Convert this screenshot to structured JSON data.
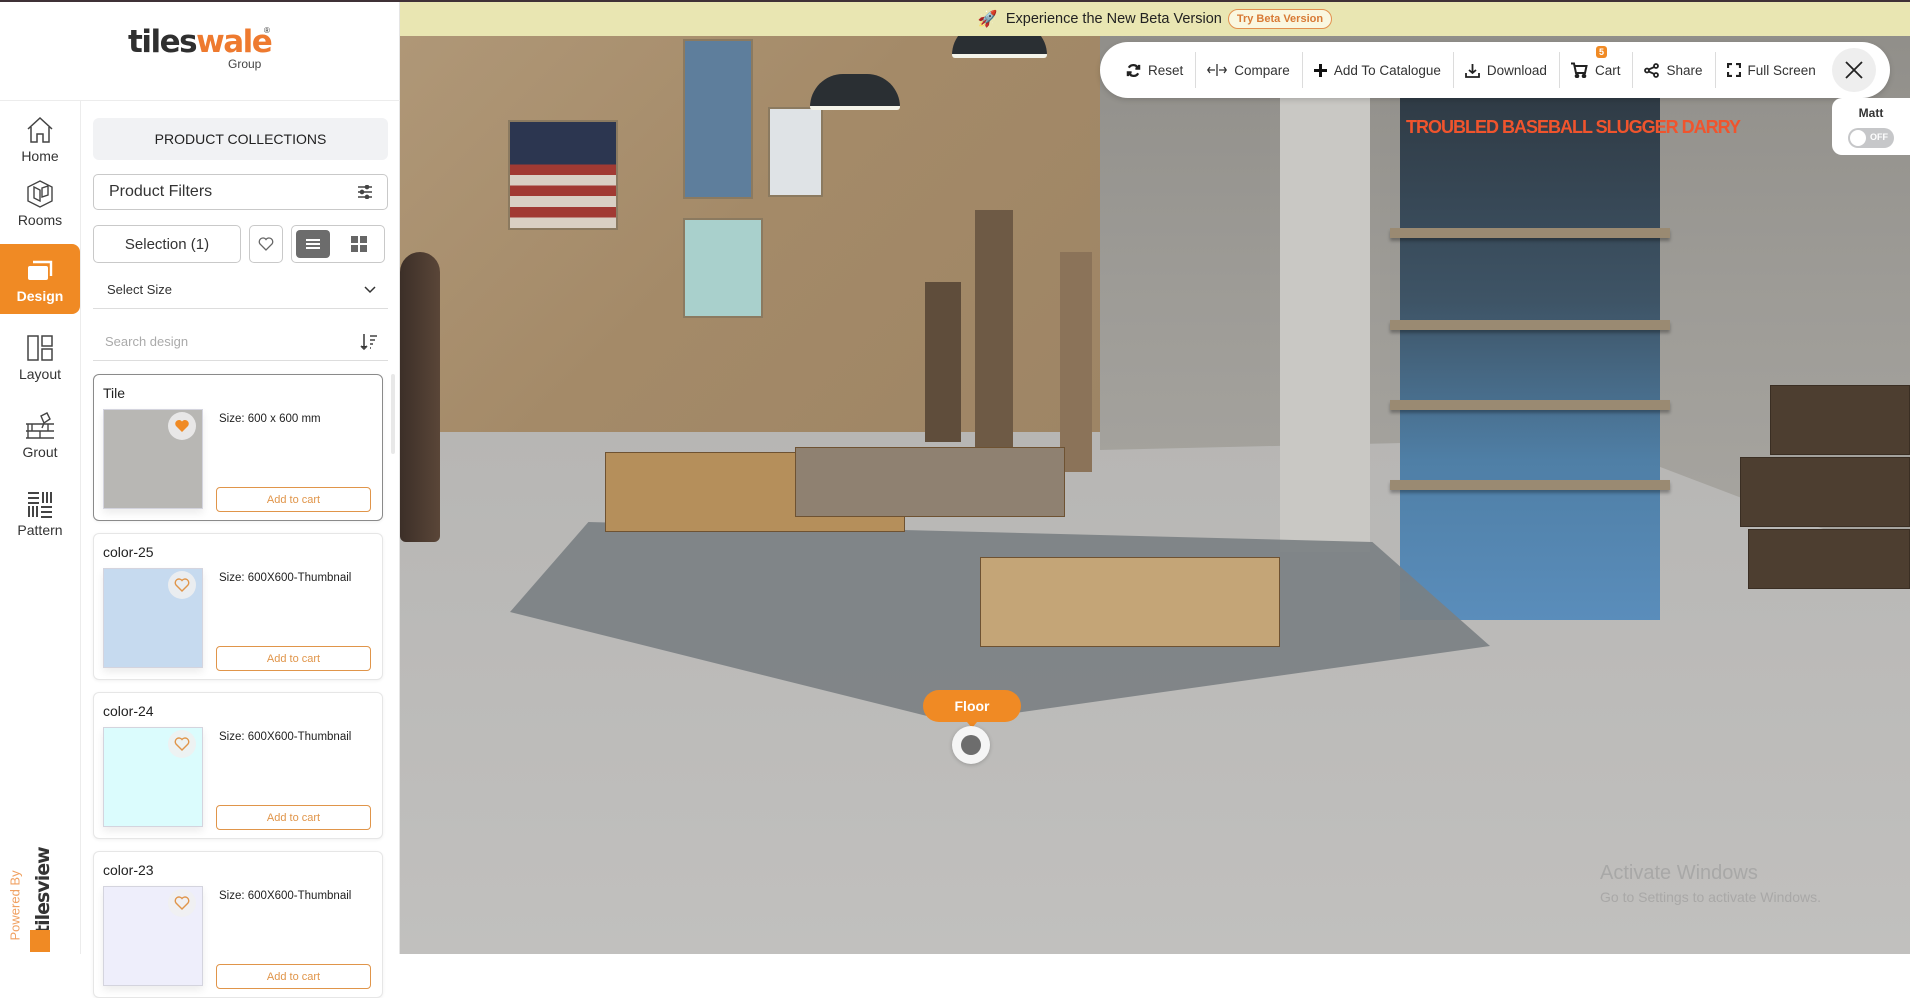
{
  "brand": {
    "name_part1": "tiles",
    "name_part2": "wale",
    "registered": "®",
    "subtitle": "Group"
  },
  "nav": {
    "items": [
      {
        "label": "Home",
        "icon": "home-icon",
        "active": false
      },
      {
        "label": "Rooms",
        "icon": "rooms-icon",
        "active": false
      },
      {
        "label": "Design",
        "icon": "design-icon",
        "active": true
      },
      {
        "label": "Layout",
        "icon": "layout-icon",
        "active": false
      },
      {
        "label": "Grout",
        "icon": "grout-icon",
        "active": false
      },
      {
        "label": "Pattern",
        "icon": "pattern-icon",
        "active": false
      }
    ],
    "powered_by": "Powered By",
    "powered_brand": "tilesview"
  },
  "panel": {
    "collections_label": "PRODUCT COLLECTIONS",
    "filters_label": "Product Filters",
    "selection_label": "Selection (1)",
    "size_select_label": "Select Size",
    "search_placeholder": "Search design",
    "view_mode": "list",
    "products": [
      {
        "title": "Tile",
        "size": "Size: 600 x 600 mm",
        "color": "#b8b7b4",
        "favorited": true,
        "selected": true,
        "button": "Add to cart"
      },
      {
        "title": "color-25",
        "size": "Size: 600X600-Thumbnail",
        "color": "#c6daef",
        "favorited": false,
        "selected": false,
        "button": "Add to cart"
      },
      {
        "title": "color-24",
        "size": "Size: 600X600-Thumbnail",
        "color": "#dbfcfd",
        "favorited": false,
        "selected": false,
        "button": "Add to cart"
      },
      {
        "title": "color-23",
        "size": "Size: 600X600-Thumbnail",
        "color": "#eeeefb",
        "favorited": false,
        "selected": false,
        "button": "Add to cart"
      }
    ]
  },
  "banner": {
    "text": "Experience the New Beta Version",
    "button": "Try Beta Version"
  },
  "toolbar": {
    "reset": "Reset",
    "compare": "Compare",
    "add_catalogue": "Add To Catalogue",
    "download": "Download",
    "cart": "Cart",
    "cart_count": "5",
    "share": "Share",
    "fullscreen": "Full Screen"
  },
  "finish_toggle": {
    "label": "Matt",
    "state": "OFF"
  },
  "scene": {
    "surface_tag": "Floor",
    "sign_text": "TROUBLED BASEBALL SLUGGER DARRY",
    "watermark_line1": "Activate Windows",
    "watermark_line2": "Go to Settings to activate Windows."
  },
  "colors": {
    "accent": "#f08a24",
    "banner_bg": "#e9e6b2",
    "brand_dark": "#2f2f2f"
  }
}
